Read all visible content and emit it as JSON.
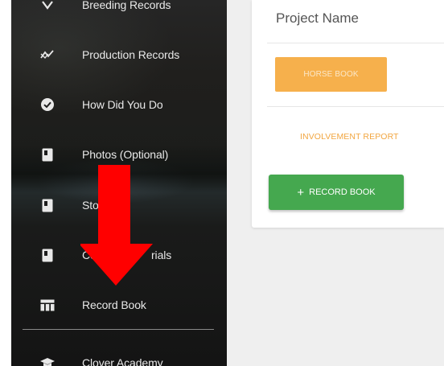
{
  "sidebar": {
    "items": [
      {
        "label": "Breeding Records",
        "icon": "checkmark-partial-icon"
      },
      {
        "label": "Production Records",
        "icon": "trending-icon"
      },
      {
        "label": "How Did You Do",
        "icon": "check-circle-icon"
      },
      {
        "label": "Photos (Optional)",
        "icon": "book-icon"
      },
      {
        "label": "Sto",
        "icon": "book-icon"
      },
      {
        "label": "Co",
        "label_end": "rials",
        "icon": "book-icon"
      },
      {
        "label": "Record Book",
        "icon": "table-icon"
      },
      {
        "label": "Clover Academy",
        "icon": "graduation-cap-icon"
      }
    ]
  },
  "main": {
    "heading": "Project Name",
    "horse_book_label": "HORSE BOOK",
    "involvement_label": "INVOLVEMENT REPORT",
    "record_book_label": "RECORD BOOK",
    "record_book_plus": "+"
  },
  "colors": {
    "horse_button": "#f6b04c",
    "involvement_link": "#f2a640",
    "record_button": "#45a84f",
    "annotation_arrow": "#ff0000"
  }
}
